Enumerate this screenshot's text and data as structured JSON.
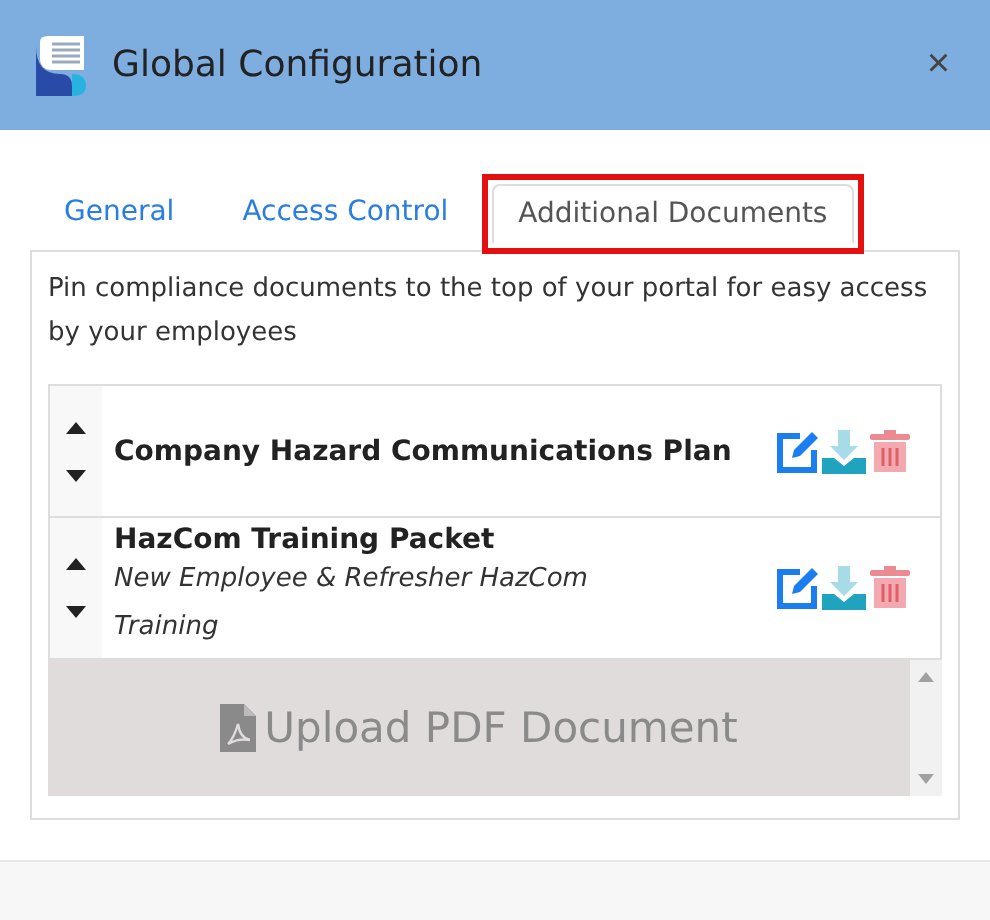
{
  "window": {
    "title": "Global Configuration",
    "close": "×"
  },
  "tabs": [
    {
      "label": "General",
      "selected": false
    },
    {
      "label": "Access Control",
      "selected": false
    },
    {
      "label": "Additional Documents",
      "selected": true,
      "highlighted": true
    }
  ],
  "description": "Pin compliance documents to the top of your portal for easy access by your employees",
  "documents": [
    {
      "title": "Company Hazard Communications Plan"
    },
    {
      "title": "HazCom Training Packet",
      "subtitle": "New Employee & Refresher HazCom Training"
    }
  ],
  "upload": {
    "label": "Upload PDF Document"
  }
}
